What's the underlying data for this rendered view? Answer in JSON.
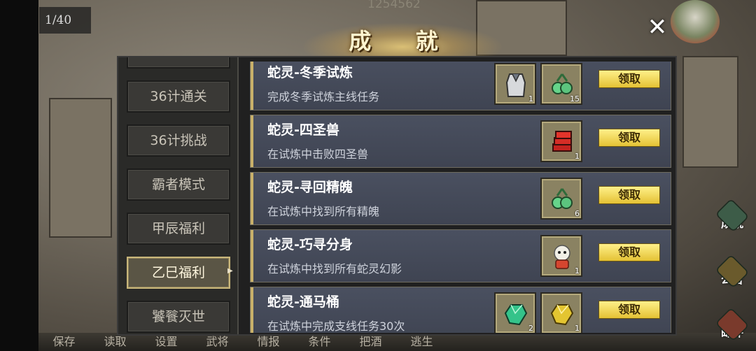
{
  "hud": {
    "counter": "1/40",
    "score": "1254562"
  },
  "window": {
    "title": "成 就",
    "close_icon": "close-icon"
  },
  "sidebar": {
    "items": [
      {
        "label": ""
      },
      {
        "label": "36计通关"
      },
      {
        "label": "36计挑战"
      },
      {
        "label": "霸者模式"
      },
      {
        "label": "甲辰福利"
      },
      {
        "label": "乙巳福利",
        "active": true
      },
      {
        "label": "饕餮灭世"
      }
    ]
  },
  "achievements": [
    {
      "name": "蛇灵-冬季试炼",
      "desc": "完成冬季试炼主线任务",
      "claim": "领取",
      "rewards": [
        {
          "icon": "robe-armor-icon",
          "qty": "1"
        },
        {
          "icon": "green-fruit-icon",
          "qty": "15"
        }
      ]
    },
    {
      "name": "蛇灵-四圣兽",
      "desc": "在试炼中击败四圣兽",
      "claim": "领取",
      "rewards": [
        {
          "icon": "red-book-stack-icon",
          "qty": "1"
        }
      ]
    },
    {
      "name": "蛇灵-寻回精魄",
      "desc": "在试炼中找到所有精魄",
      "claim": "领取",
      "rewards": [
        {
          "icon": "green-fruit-icon",
          "qty": "6"
        }
      ]
    },
    {
      "name": "蛇灵-巧寻分身",
      "desc": "在试炼中找到所有蛇灵幻影",
      "claim": "领取",
      "rewards": [
        {
          "icon": "snake-spirit-avatar-icon",
          "qty": "1"
        }
      ]
    },
    {
      "name": "蛇灵-通马桶",
      "desc": "在试炼中完成支线任务30次",
      "claim": "领取",
      "rewards": [
        {
          "icon": "green-gem-icon",
          "qty": "2"
        },
        {
          "icon": "gold-gem-icon",
          "qty": "1"
        }
      ]
    }
  ],
  "right_menu": {
    "achievement": "成就",
    "notice": "公告",
    "mail": "邮件"
  },
  "bottom_bar": [
    "保存",
    "读取",
    "设置",
    "武将",
    "情报",
    "条件",
    "把酒",
    "逃生"
  ]
}
